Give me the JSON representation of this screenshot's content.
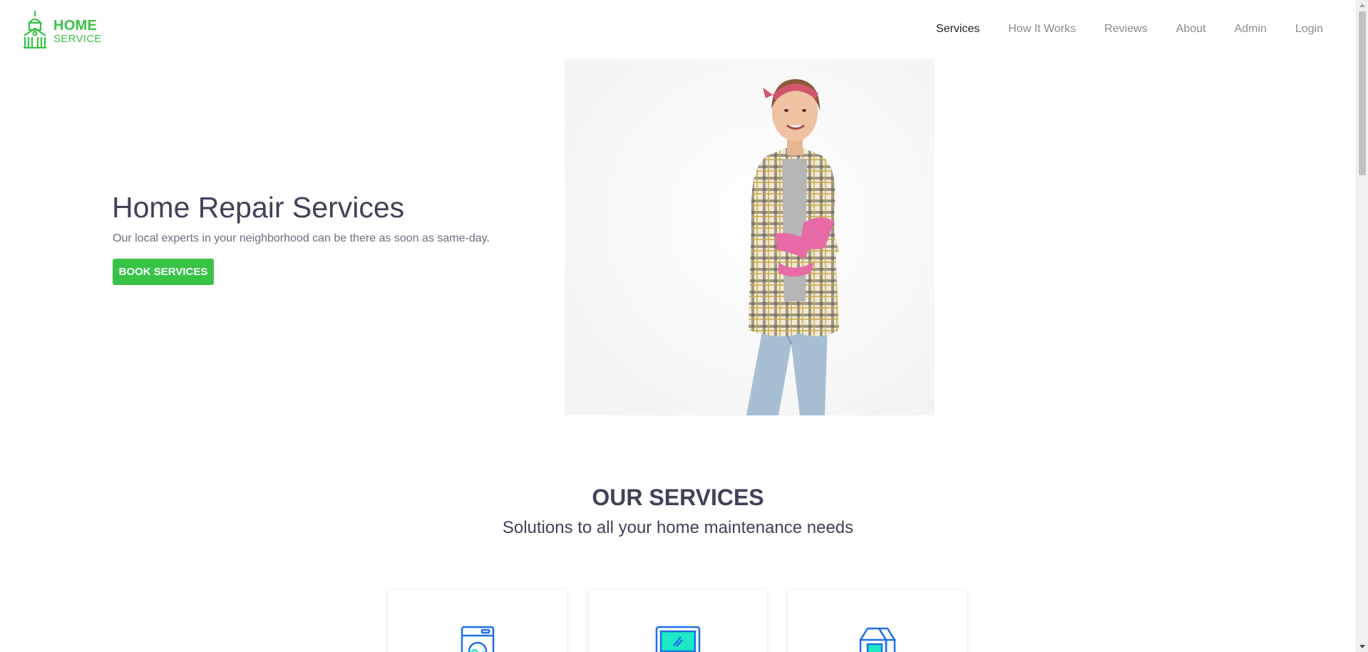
{
  "header": {
    "logo": {
      "line1": "HOME",
      "line2": "SERVICE",
      "icon": "building-icon"
    },
    "nav": [
      {
        "label": "Services",
        "active": true
      },
      {
        "label": "How It Works",
        "active": false
      },
      {
        "label": "Reviews",
        "active": false
      },
      {
        "label": "About",
        "active": false
      },
      {
        "label": "Admin",
        "active": false
      },
      {
        "label": "Login",
        "active": false
      }
    ]
  },
  "hero": {
    "title": "Home Repair Services",
    "subtitle": "Our local experts in your neighborhood can be there as soon as same-day.",
    "button_label": "BOOK SERVICES"
  },
  "services": {
    "title": "OUR SERVICES",
    "subtitle": "Solutions to all your home maintenance needs",
    "cards": [
      {
        "icon": "washing-machine-icon"
      },
      {
        "icon": "microwave-icon"
      },
      {
        "icon": "fridge-icon"
      }
    ]
  },
  "colors": {
    "brand_green": "#37c346",
    "heading": "#3f4257",
    "nav_inactive": "#8b8b8b",
    "icon_blue": "#1e6fe8",
    "icon_teal": "#1de9c6"
  }
}
